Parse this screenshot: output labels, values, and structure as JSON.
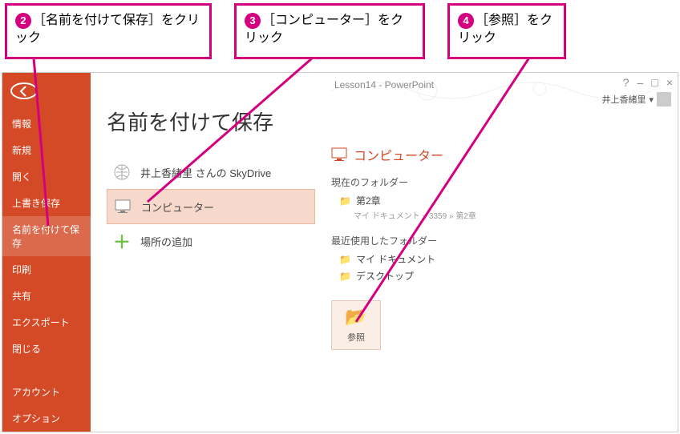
{
  "callouts": [
    {
      "num": "2",
      "text": "［名前を付けて保存］をクリック"
    },
    {
      "num": "3",
      "text": "［コンピューター］をクリック"
    },
    {
      "num": "4",
      "text": "［参照］をクリック"
    }
  ],
  "titlebar": {
    "title": "Lesson14 - PowerPoint",
    "user": "井上香緒里"
  },
  "sidebar": {
    "items": [
      "情報",
      "新規",
      "開く",
      "上書き保存",
      "名前を付けて保存",
      "印刷",
      "共有",
      "エクスポート",
      "閉じる"
    ],
    "bottom": [
      "アカウント",
      "オプション"
    ],
    "selectedIndex": 4
  },
  "page": {
    "heading": "名前を付けて保存"
  },
  "locations": {
    "skydrive": "井上香緒里 さんの SkyDrive",
    "computer": "コンピューター",
    "add": "場所の追加"
  },
  "rightPane": {
    "title": "コンピューター",
    "currentFolderLabel": "現在のフォルダー",
    "currentFolder": {
      "name": "第2章",
      "path": "マイ ドキュメント » 3359 » 第2章"
    },
    "recentLabel": "最近使用したフォルダー",
    "recent": [
      "マイ ドキュメント",
      "デスクトップ"
    ],
    "browse": "参照"
  }
}
